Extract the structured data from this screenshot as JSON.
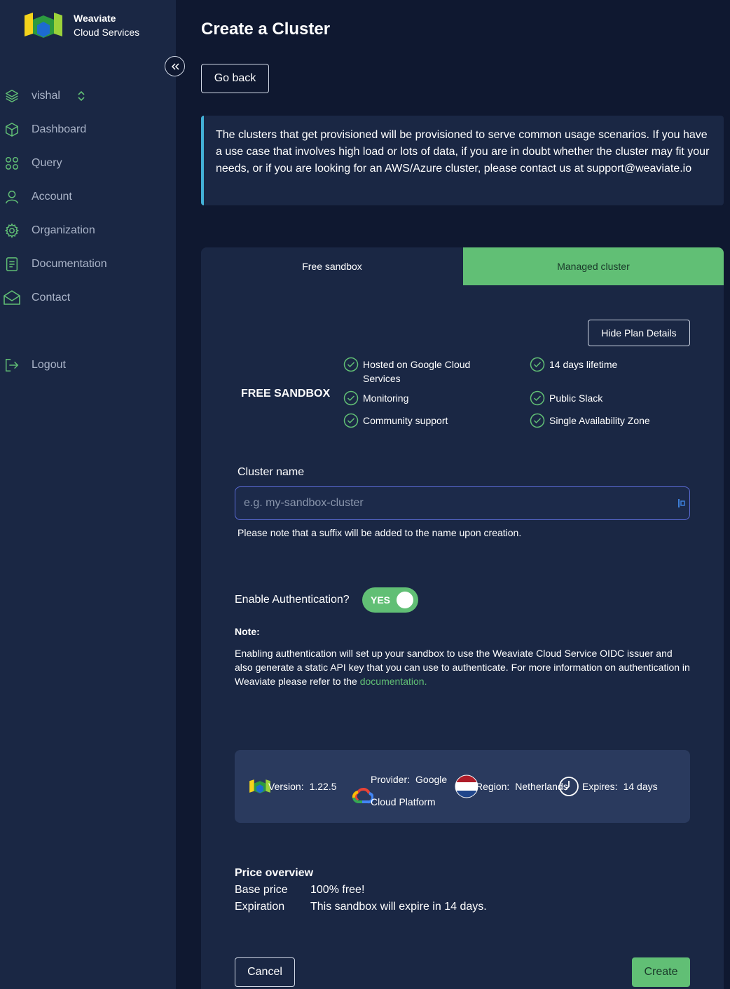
{
  "sidebar": {
    "brand_line1": "Weaviate",
    "brand_line2": "Cloud Services",
    "items": [
      {
        "label": "vishal",
        "icon": "layers-icon"
      },
      {
        "label": "Dashboard",
        "icon": "cube-icon"
      },
      {
        "label": "Query",
        "icon": "grid-circles-icon"
      },
      {
        "label": "Account",
        "icon": "user-icon"
      },
      {
        "label": "Organization",
        "icon": "gear-icon"
      },
      {
        "label": "Documentation",
        "icon": "document-icon"
      },
      {
        "label": "Contact",
        "icon": "envelope-icon"
      },
      {
        "label": "Logout",
        "icon": "logout-icon"
      }
    ]
  },
  "header": {
    "title": "Create a Cluster",
    "go_back": "Go back"
  },
  "info": {
    "text": "The clusters that get provisioned will be provisioned to serve common usage scenarios. If you have a use case that involves high load or lots of data, if you are in doubt whether the cluster may fit your needs, or if you are looking for an AWS/Azure cluster, please contact us at support@weaviate.io"
  },
  "tabs": {
    "free": "Free sandbox",
    "managed": "Managed cluster"
  },
  "plan": {
    "hide_button": "Hide Plan Details",
    "name": "FREE SANDBOX",
    "features": [
      "Hosted on Google Cloud Services",
      "14 days lifetime",
      "Monitoring",
      "Public Slack",
      "Community support",
      "Single Availability Zone"
    ]
  },
  "cluster": {
    "label": "Cluster name",
    "placeholder": "e.g. my-sandbox-cluster",
    "value": "",
    "hint": "Please note that a suffix will be added to the name upon creation."
  },
  "auth": {
    "label": "Enable Authentication?",
    "toggle": "YES",
    "note_title": "Note:",
    "note_text": "Enabling authentication will set up your sandbox to use the Weaviate Cloud Service OIDC issuer and also generate a static API key that you can use to authenticate. For more information on authentication in Weaviate please refer to the ",
    "note_link": "documentation."
  },
  "summary": {
    "version_key": "Version:",
    "version_val": "1.22.5",
    "provider_key": "Provider:",
    "provider_val1": "Google",
    "provider_val2": "Cloud Platform",
    "region_key": "Region:",
    "region_val": "Netherlands",
    "expires_key": "Expires:",
    "expires_val": "14 days"
  },
  "price": {
    "title": "Price overview",
    "base_key": "Base price",
    "base_val": "100% free!",
    "exp_key": "Expiration",
    "exp_val": "This sandbox will expire in 14 days."
  },
  "actions": {
    "cancel": "Cancel",
    "create": "Create"
  },
  "colors": {
    "accent": "#61bf75",
    "info_border": "#43b0d6",
    "sidebar_bg": "#1a2744",
    "page_bg": "#0f1830"
  }
}
